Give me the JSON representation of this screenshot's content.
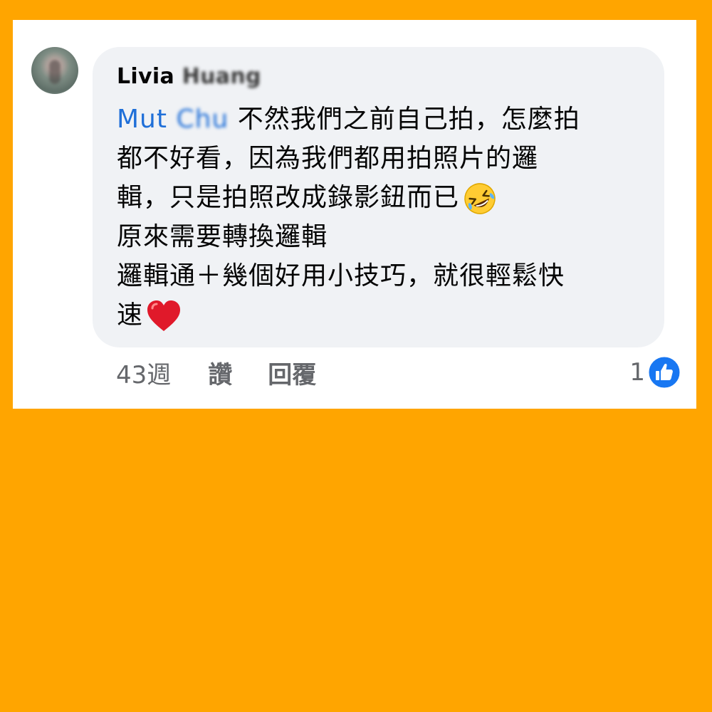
{
  "comment": {
    "author_first": "Livia",
    "author_last": "Huang",
    "mention_first": "Mut",
    "mention_last": "Chu",
    "lines": [
      "不然我們之前自己拍，怎麼拍",
      "都不好看，因為我們都用拍照片的邏",
      "輯，只是拍照改成錄影鈕而已",
      "原來需要轉換邏輯",
      "邏輯通＋幾個好用小技巧，就很輕鬆快",
      "速"
    ],
    "line3_emoji": "rolling-on-floor-laughing-emoji",
    "line6_emoji": "red-heart-emoji"
  },
  "actions": {
    "time": "43週",
    "like_label": "讚",
    "reply_label": "回覆"
  },
  "reactions": {
    "count": "1",
    "icon": "like-thumbs-up-icon",
    "icon_color": "#1877F2"
  },
  "colors": {
    "background": "#FFA500",
    "bubble": "#F0F2F5",
    "mention": "#1F6FD8",
    "meta_text": "#65676B"
  }
}
